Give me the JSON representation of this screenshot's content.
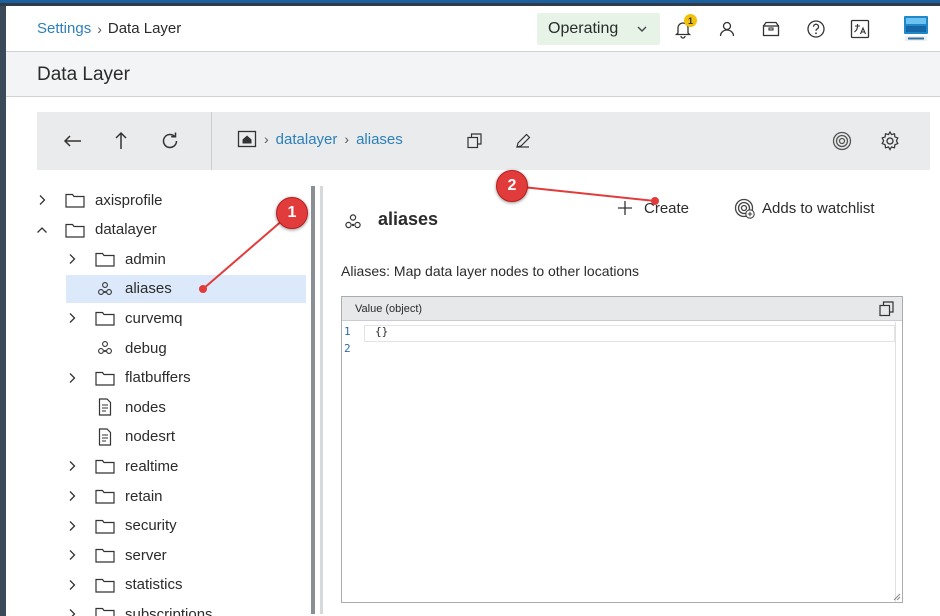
{
  "header": {
    "breadcrumb_root": "Settings",
    "breadcrumb_current": "Data Layer",
    "operating_mode": "Operating",
    "notification_count": "1"
  },
  "page": {
    "title": "Data Layer"
  },
  "toolbar": {
    "path": [
      "datalayer",
      "aliases"
    ]
  },
  "tree": {
    "items": [
      {
        "label": "axisprofile",
        "type": "folder",
        "expanded": false
      },
      {
        "label": "datalayer",
        "type": "folder",
        "expanded": true
      },
      {
        "label": "admin",
        "type": "folder",
        "expanded": false
      },
      {
        "label": "aliases",
        "type": "node",
        "selected": true
      },
      {
        "label": "curvemq",
        "type": "folder",
        "expanded": false
      },
      {
        "label": "debug",
        "type": "node"
      },
      {
        "label": "flatbuffers",
        "type": "folder",
        "expanded": false
      },
      {
        "label": "nodes",
        "type": "file"
      },
      {
        "label": "nodesrt",
        "type": "file"
      },
      {
        "label": "realtime",
        "type": "folder",
        "expanded": false
      },
      {
        "label": "retain",
        "type": "folder",
        "expanded": false
      },
      {
        "label": "security",
        "type": "folder",
        "expanded": false
      },
      {
        "label": "server",
        "type": "folder",
        "expanded": false
      },
      {
        "label": "statistics",
        "type": "folder",
        "expanded": false
      },
      {
        "label": "subscriptions",
        "type": "folder",
        "expanded": false
      }
    ]
  },
  "detail": {
    "title": "aliases",
    "create_label": "Create",
    "watchlist_label": "Adds to watchlist",
    "description": "Aliases: Map data layer nodes to other locations",
    "editor_header": "Value (object)",
    "lines": [
      {
        "num": "1",
        "code": "{}"
      },
      {
        "num": "2",
        "code": ""
      }
    ]
  },
  "annotations": {
    "marker_1": "1",
    "marker_2": "2",
    "color": "#e23b3b"
  },
  "colors": {
    "link": "#2c80b9",
    "mode_bg": "#e6f3e6",
    "selected_row": "#dbe9fa",
    "badge": "#f2c10d"
  }
}
